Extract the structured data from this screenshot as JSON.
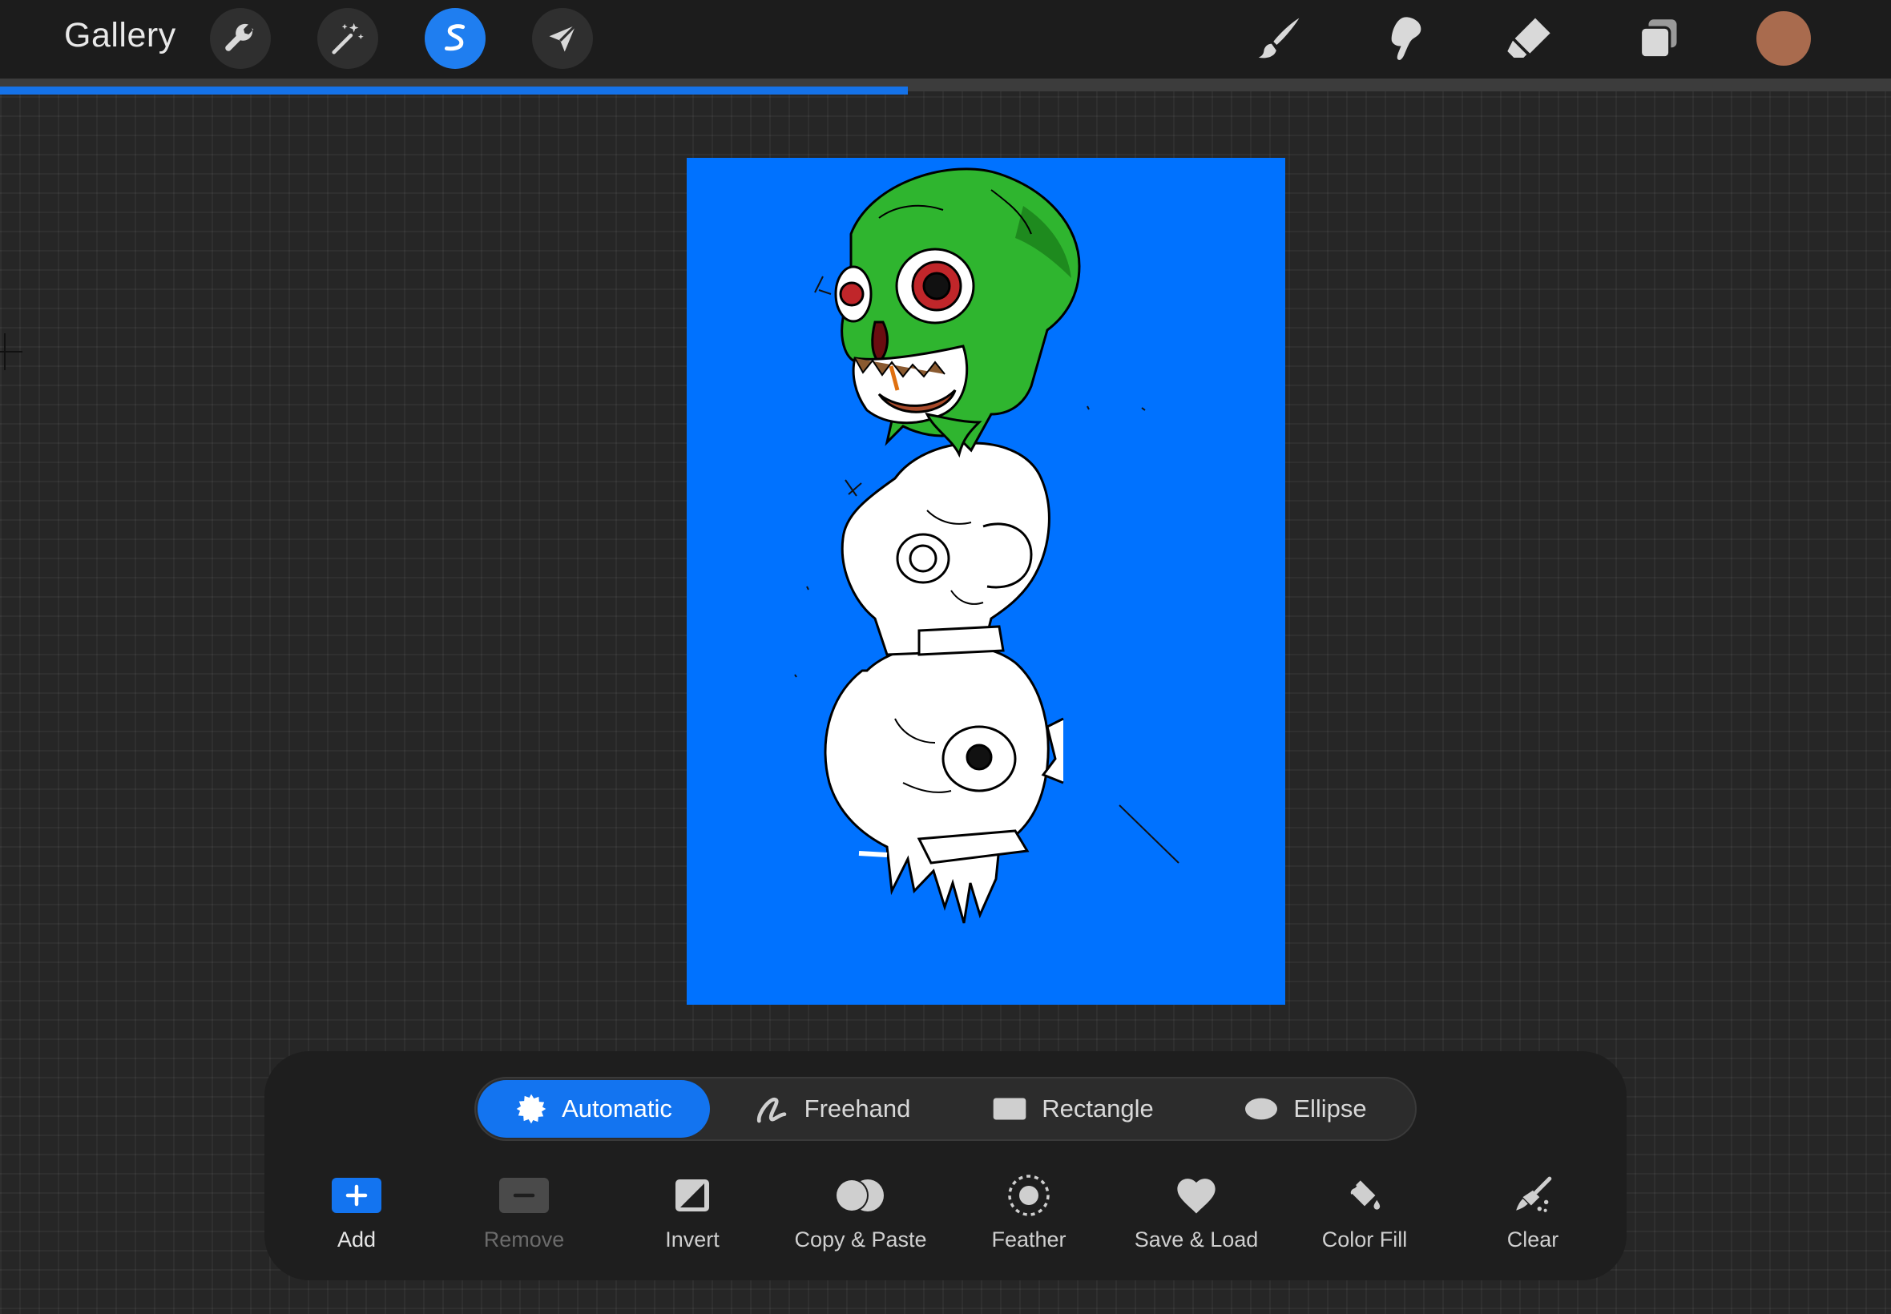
{
  "topbar": {
    "gallery_label": "Gallery",
    "left_tools": [
      "wrench-icon",
      "magic-wand-icon",
      "selection-icon",
      "move-arrow-icon"
    ],
    "active_tool": "selection-icon",
    "right_tools": [
      "brush-icon",
      "smudge-icon",
      "eraser-icon",
      "layers-icon"
    ],
    "current_color": "#a96b4e"
  },
  "progress": {
    "fraction": 0.48,
    "color": "#1572e8"
  },
  "canvas": {
    "background_color": "#0072ff",
    "artwork": "stacked-skulls-illustration"
  },
  "selection_modes": {
    "active": "Automatic",
    "items": [
      {
        "label": "Automatic",
        "icon": "automatic-burst-icon"
      },
      {
        "label": "Freehand",
        "icon": "freehand-loop-icon"
      },
      {
        "label": "Rectangle",
        "icon": "rectangle-icon"
      },
      {
        "label": "Ellipse",
        "icon": "ellipse-icon"
      }
    ]
  },
  "actions": [
    {
      "label": "Add",
      "icon": "add-plus-icon",
      "state": "primary"
    },
    {
      "label": "Remove",
      "icon": "remove-minus-icon",
      "state": "disabled"
    },
    {
      "label": "Invert",
      "icon": "invert-icon",
      "state": "normal"
    },
    {
      "label": "Copy & Paste",
      "icon": "copy-paste-icon",
      "state": "normal"
    },
    {
      "label": "Feather",
      "icon": "feather-icon",
      "state": "normal"
    },
    {
      "label": "Save & Load",
      "icon": "heart-icon",
      "state": "normal"
    },
    {
      "label": "Color Fill",
      "icon": "color-fill-icon",
      "state": "normal"
    },
    {
      "label": "Clear",
      "icon": "clear-brush-icon",
      "state": "normal"
    }
  ]
}
